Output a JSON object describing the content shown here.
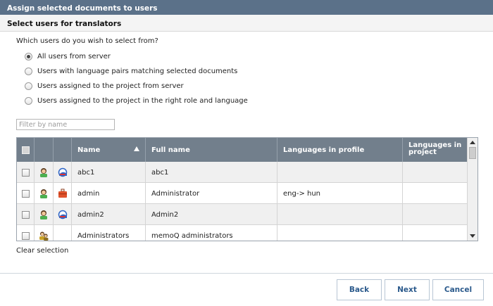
{
  "window": {
    "title": "Assign selected documents to users"
  },
  "section": {
    "title": "Select users for translators"
  },
  "question": "Which users do you wish to select from?",
  "options": [
    {
      "label": "All users from server",
      "selected": true
    },
    {
      "label": "Users with language pairs matching selected documents",
      "selected": false
    },
    {
      "label": "Users assigned to the project from server",
      "selected": false
    },
    {
      "label": "Users assigned to the project in the right role and language",
      "selected": false
    }
  ],
  "filter": {
    "placeholder": "Filter by name",
    "value": ""
  },
  "table": {
    "columns": [
      {
        "label": ""
      },
      {
        "label": ""
      },
      {
        "label": ""
      },
      {
        "label": "Name",
        "sort": "ascending"
      },
      {
        "label": "Full name"
      },
      {
        "label": "Languages in profile"
      },
      {
        "label": "Languages in project"
      }
    ],
    "rows": [
      {
        "icon1": "user-icon",
        "icon2": "memoq-client-icon",
        "name": "abc1",
        "full_name": "abc1",
        "languages_in_profile": "",
        "languages_in_project": ""
      },
      {
        "icon1": "user-icon",
        "icon2": "briefcase-icon",
        "name": "admin",
        "full_name": "Administrator",
        "languages_in_profile": "eng-> hun",
        "languages_in_project": ""
      },
      {
        "icon1": "user-icon",
        "icon2": "memoq-client-icon",
        "name": "admin2",
        "full_name": "Admin2",
        "languages_in_profile": "",
        "languages_in_project": ""
      },
      {
        "icon1": "group-icon",
        "icon2": "",
        "name": "Administrators",
        "full_name": "memoQ administrators",
        "languages_in_profile": "",
        "languages_in_project": ""
      }
    ]
  },
  "clear_selection": "Clear selection",
  "buttons": {
    "back": "Back",
    "next": "Next",
    "cancel": "Cancel"
  },
  "colors": {
    "titlebar": "#5b7189",
    "table_header": "#727f8c",
    "button_text": "#2b5a8c"
  }
}
